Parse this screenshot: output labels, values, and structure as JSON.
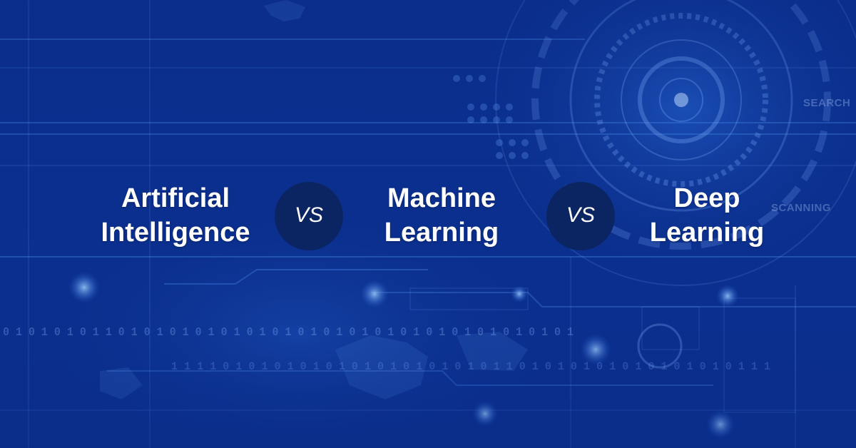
{
  "background": {
    "binary_top": "0 1 0 1 0 1 0 1 1 0 1 0 1 0 1 0 1 0 1 0 1 0 1 0 1 0 1 0 1 0 1 0 1 0 1 0 1 0 1 0 1 0 1 0 1",
    "binary_bottom": "1 1 1 1 0 1 0 1 0 1 0 1 0 1 0 1 0 1 0 1 0 1 0 1 0 1 1 0 1 0 1 0 1 0 1 0 1 0 1 0 1 0 1 0 1 1 1",
    "label_search": "SEARCH",
    "label_scanning": "SCANNING",
    "colors": {
      "base": "#0b2f8e",
      "circle": "#0b2563",
      "text": "#ffffff"
    }
  },
  "headline": {
    "ai": {
      "line1": "Artificial",
      "line2": "Intelligence"
    },
    "vs1": "VS",
    "ml": {
      "line1": "Machine",
      "line2": "Learning"
    },
    "vs2": "VS",
    "dl": {
      "line1": "Deep",
      "line2": "Learning"
    }
  }
}
